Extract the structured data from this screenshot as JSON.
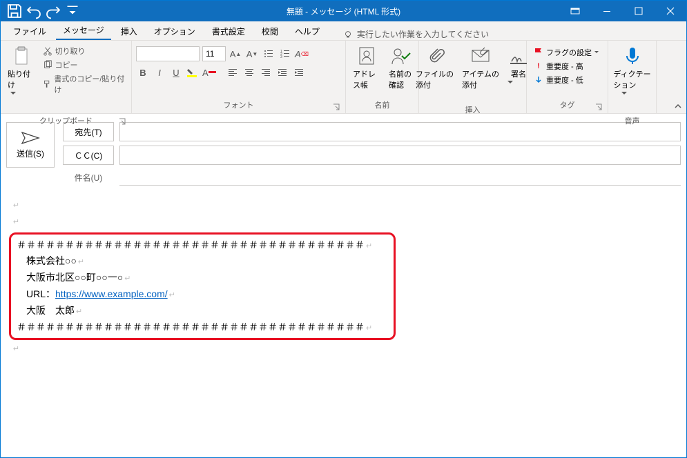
{
  "window": {
    "title": "無題  -  メッセージ (HTML 形式)"
  },
  "tabs": {
    "file": "ファイル",
    "message": "メッセージ",
    "insert": "挿入",
    "options": "オプション",
    "format": "書式設定",
    "review": "校閲",
    "help": "ヘルプ",
    "tellme": "実行したい作業を入力してください"
  },
  "ribbon": {
    "clipboard": {
      "label": "クリップボード",
      "paste": "貼り付け",
      "cut": "切り取り",
      "copy": "コピー",
      "formatpainter": "書式のコピー/貼り付け"
    },
    "font": {
      "label": "フォント",
      "size": "11"
    },
    "names": {
      "label": "名前",
      "addressbook": "アドレス帳",
      "checknames": "名前の\n確認"
    },
    "include": {
      "label": "挿入",
      "attachfile": "ファイルの\n添付",
      "attachitem": "アイテムの\n添付",
      "signature": "署名"
    },
    "tags": {
      "label": "タグ",
      "followup": "フラグの設定",
      "high": "重要度 - 高",
      "low": "重要度 - 低"
    },
    "voice": {
      "label": "音声",
      "dictate": "ディクテー\nション"
    }
  },
  "compose": {
    "send": "送信(S)",
    "to": "宛先(T)",
    "cc": "ＣＣ(C)",
    "subject": "件名(U)"
  },
  "body": {
    "sig_border_top": "＃＃＃＃＃＃＃＃＃＃＃＃＃＃＃＃＃＃＃＃＃＃＃＃＃＃＃＃＃＃＃＃＃＃＃＃",
    "sig_company": "株式会社○○",
    "sig_address": "大阪市北区○○町○○一○",
    "sig_url_label": "URL：",
    "sig_url": "https://www.example.com/",
    "sig_name": "大阪　太郎",
    "sig_border_bottom": "＃＃＃＃＃＃＃＃＃＃＃＃＃＃＃＃＃＃＃＃＃＃＃＃＃＃＃＃＃＃＃＃＃＃＃＃"
  }
}
